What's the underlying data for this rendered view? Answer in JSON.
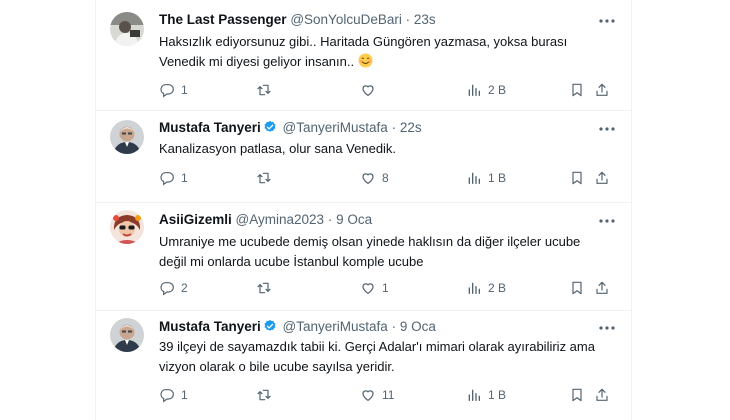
{
  "tweets": [
    {
      "name": "The Last Passenger",
      "handle": "@SonYolcuDeBari",
      "separator": "·",
      "time": "23s",
      "verified": false,
      "text": "Haksızlık ediyorsunuz gibi.. Haritada Güngören yazmasa, yoksa burası Venedik mi diyesi geliyor insanın..",
      "emoji": "smiling-face-icon",
      "replies": "1",
      "retweets": "",
      "likes": "",
      "views": "2 B"
    },
    {
      "name": "Mustafa Tanyeri",
      "handle": "@TanyeriMustafa",
      "separator": "·",
      "time": "22s",
      "verified": true,
      "text": "Kanalizasyon patlasa, olur sana Venedik.",
      "replies": "1",
      "retweets": "",
      "likes": "8",
      "views": "1 B"
    },
    {
      "name": "AsiiGizemli",
      "handle": "@Aymina2023",
      "separator": "·",
      "time": "9 Oca",
      "verified": false,
      "text": "Umraniye me ucubede demiş olsan  yinede haklısın da diğer ilçeler ucube değil mi onlarda ucube İstanbul komple ucube",
      "replies": "2",
      "retweets": "",
      "likes": "1",
      "views": "2 B"
    },
    {
      "name": "Mustafa Tanyeri",
      "handle": "@TanyeriMustafa",
      "separator": "·",
      "time": "9 Oca",
      "verified": true,
      "text": "39 ilçeyi de sayamazdık tabii ki. Gerçi Adalar'ı mimari olarak ayırabiliriz ama vizyon olarak o bile ucube sayılsa yeridir.",
      "replies": "1",
      "retweets": "",
      "likes": "11",
      "views": "1 B"
    }
  ],
  "colors": {
    "text": "#0f1419",
    "secondary": "#536471",
    "verified": "#1d9bf0",
    "divider": "#eff3f4"
  }
}
